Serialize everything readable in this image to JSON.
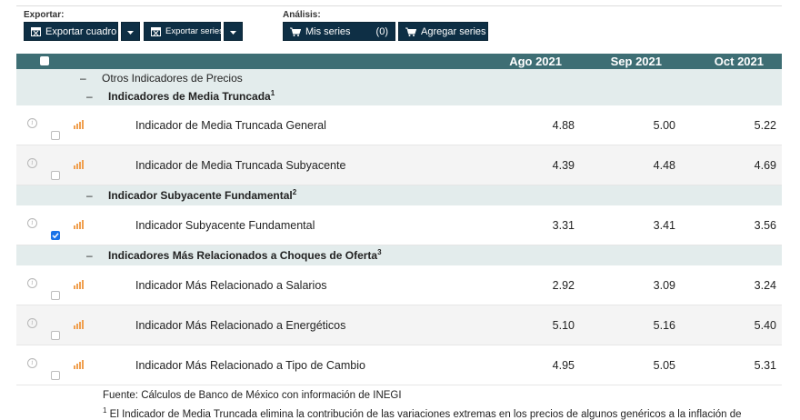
{
  "toolbar": {
    "export_label": "Exportar:",
    "analysis_label": "Análisis:",
    "export_table": "Exportar cuadro",
    "export_series": "Exportar series",
    "my_series": "Mis series",
    "my_series_count": "(0)",
    "add_series": "Agregar series"
  },
  "table": {
    "columns": [
      "Ago 2021",
      "Sep 2021",
      "Oct 2021"
    ],
    "group_root": "Otros Indicadores de Precios",
    "groups": [
      {
        "title": "Indicadores de Media Truncada",
        "note": "1",
        "rows": [
          {
            "name": "Indicador de Media Truncada General",
            "values": [
              "4.88",
              "5.00",
              "5.22"
            ],
            "checked": false
          },
          {
            "name": "Indicador de Media Truncada Subyacente",
            "values": [
              "4.39",
              "4.48",
              "4.69"
            ],
            "checked": false
          }
        ]
      },
      {
        "title": "Indicador Subyacente Fundamental",
        "note": "2",
        "rows": [
          {
            "name": "Indicador Subyacente Fundamental",
            "values": [
              "3.31",
              "3.41",
              "3.56"
            ],
            "checked": true
          }
        ]
      },
      {
        "title": "Indicadores Más Relacionados a Choques de Oferta",
        "note": "3",
        "rows": [
          {
            "name": "Indicador Más Relacionado a Salarios",
            "values": [
              "2.92",
              "3.09",
              "3.24"
            ],
            "checked": false
          },
          {
            "name": "Indicador Más Relacionado a Energéticos",
            "values": [
              "5.10",
              "5.16",
              "5.40"
            ],
            "checked": false
          },
          {
            "name": "Indicador Más Relacionado a Tipo de Cambio",
            "values": [
              "4.95",
              "5.05",
              "5.31"
            ],
            "checked": false
          }
        ]
      }
    ]
  },
  "footer": {
    "source": "Fuente: Cálculos de Banco de México con información de INEGI",
    "note_number": "1",
    "note_text": "El Indicador de Media Truncada elimina la contribución de las variaciones extremas en los precios de algunos genéricos a la inflación de"
  },
  "colors": {
    "header": "#3e6e74",
    "button": "#0e2f45",
    "group_row": "#e3ecec",
    "chart_icon": "#f0a050"
  }
}
